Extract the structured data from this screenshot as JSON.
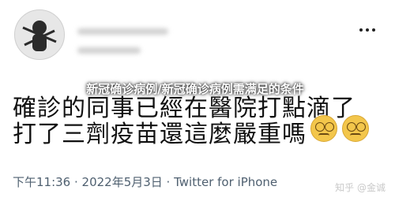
{
  "post": {
    "text_line1": "確診的同事已經在醫院打點滴了",
    "text_line2": "打了三劑疫苗還這麼嚴重嗎",
    "meta": "下午11:36 · 2022年5月3日 · Twitter for iPhone"
  },
  "overlay": {
    "title": "新冠确诊病例/新冠确诊病例需满足的条件"
  },
  "watermark": {
    "text": "知乎 @金诚"
  }
}
